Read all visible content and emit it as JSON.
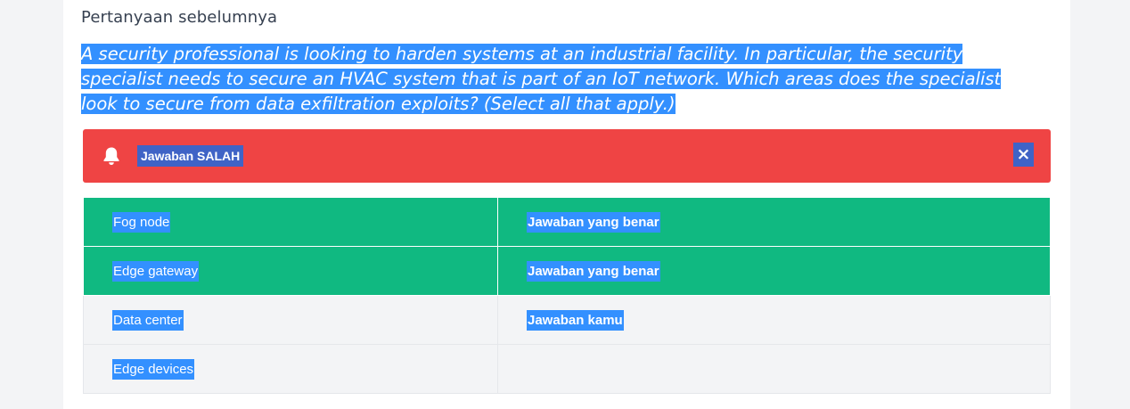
{
  "section": {
    "title": "Pertanyaan sebelumnya"
  },
  "question": {
    "text": "A security professional is looking to harden systems at an industrial facility. In particular, the security specialist needs to secure an HVAC system that is part of an IoT network. Which areas does the specialist look to secure from data exfiltration exploits? (Select all that apply.)"
  },
  "alert": {
    "icon": "bell-icon",
    "message": "Jawaban SALAH",
    "close_label": "×",
    "color": "#ef4444"
  },
  "answers": {
    "rows": [
      {
        "option": "Fog node",
        "status": "Jawaban yang benar",
        "state": "correct"
      },
      {
        "option": "Edge gateway",
        "status": "Jawaban yang benar",
        "state": "correct"
      },
      {
        "option": "Data center",
        "status": "Jawaban kamu",
        "state": "neutral"
      },
      {
        "option": "Edge devices",
        "status": "",
        "state": "neutral"
      }
    ]
  },
  "colors": {
    "correct": "#10b981",
    "neutral": "#f3f4f6",
    "selection": "#3390ff"
  }
}
